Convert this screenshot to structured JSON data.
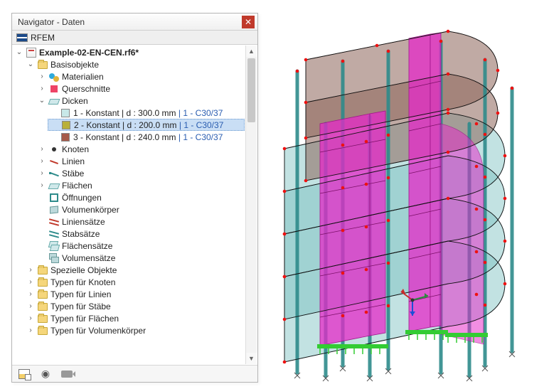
{
  "window": {
    "title": "Navigator - Daten"
  },
  "app": {
    "name": "RFEM"
  },
  "tree": {
    "root_label": "Example-02-EN-CEN.rf6*",
    "basis_label": "Basisobjekte",
    "materials_label": "Materialien",
    "sections_label": "Querschnitte",
    "thickness_label": "Dicken",
    "thickness_items": [
      {
        "text_a": "1 - Konstant | d : 300.0 mm",
        "text_b": "1 - C30/37"
      },
      {
        "text_a": "2 - Konstant | d : 200.0 mm",
        "text_b": "1 - C30/37"
      },
      {
        "text_a": "3 - Konstant | d : 240.0 mm",
        "text_b": "1 - C30/37"
      }
    ],
    "nodes_label": "Knoten",
    "lines_label": "Linien",
    "members_label": "Stäbe",
    "surfaces_label": "Flächen",
    "openings_label": "Öffnungen",
    "solids_label": "Volumenkörper",
    "linesets_label": "Liniensätze",
    "membersets_label": "Stabsätze",
    "surfacesets_label": "Flächensätze",
    "solidsets_label": "Volumensätze",
    "special_label": "Spezielle Objekte",
    "types_nodes_label": "Typen für Knoten",
    "types_lines_label": "Typen für Linien",
    "types_members_label": "Typen für Stäbe",
    "types_surfaces_label": "Typen für Flächen",
    "types_solids_label": "Typen für Volumenkörper"
  },
  "sep": " | "
}
